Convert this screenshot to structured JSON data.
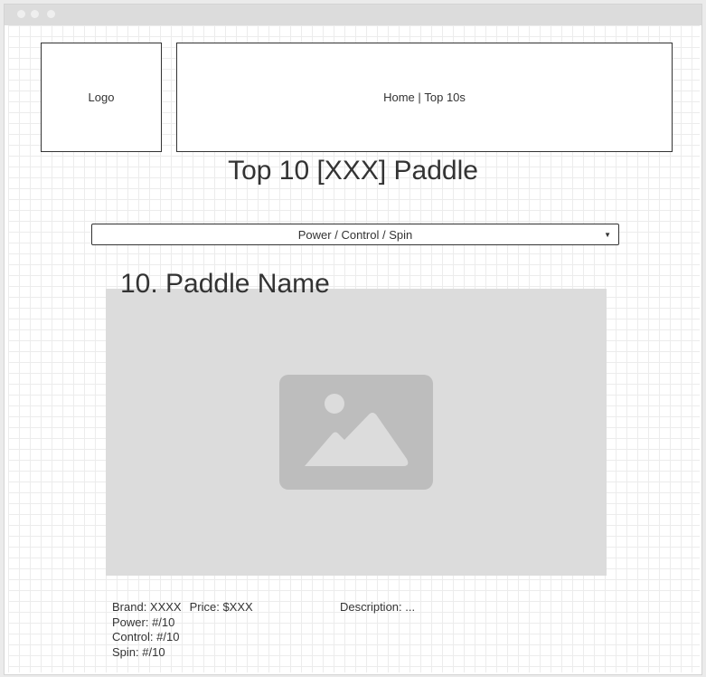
{
  "header": {
    "logo_label": "Logo",
    "nav_home": "Home",
    "nav_separator": " | ",
    "nav_top10s": "Top 10s"
  },
  "main": {
    "title": "Top 10 [XXX] Paddle",
    "filter": {
      "selected": "Power / Control / Spin"
    }
  },
  "paddle": {
    "heading": "10. Paddle Name",
    "image_icon": "image-placeholder-icon",
    "brand": "Brand: XXXX",
    "price": "Price: $XXX",
    "power": "Power: #/10",
    "control": "Control: #/10",
    "spin": "Spin: #/10",
    "description": "Description: ..."
  },
  "colors": {
    "grid_line": "#ececec",
    "placeholder_bg": "#dcdcdc",
    "placeholder_icon": "#bdbdbd",
    "text": "#333333"
  }
}
